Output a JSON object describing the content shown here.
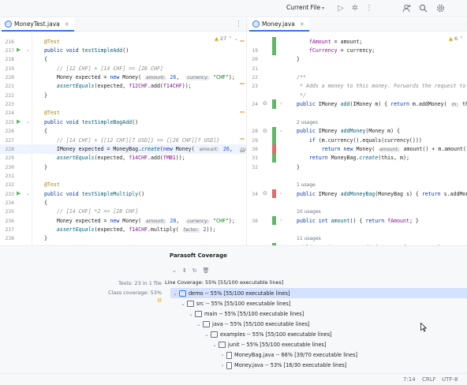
{
  "toolbar": {
    "run_config": "Current File",
    "icons": [
      "run-icon",
      "debug-icon",
      "more-icon",
      "add-user-icon",
      "search-icon",
      "settings-icon"
    ]
  },
  "left_tab": {
    "label": "MoneyTest.java"
  },
  "right_tab": {
    "label": "Money.java"
  },
  "left_editor": {
    "warning_count": "27",
    "lines": [
      {
        "n": "216",
        "parts": [
          [
            "ann",
            "@Test"
          ]
        ]
      },
      {
        "n": "217",
        "parts": [
          [
            "kw",
            "public void "
          ],
          [
            "fn",
            "testSimpleAdd"
          ],
          [
            "",
            "()"
          ]
        ]
      },
      {
        "n": "218",
        "parts": [
          [
            "",
            "{"
          ]
        ]
      },
      {
        "n": "219",
        "parts": [
          [
            "cm",
            "    // [12 CHF] + [14 CHF] == [26 CHF]"
          ]
        ]
      },
      {
        "n": "220",
        "parts": [
          [
            "",
            "    Money expected = "
          ],
          [
            "kw",
            "new "
          ],
          [
            "",
            "Money( "
          ],
          [
            "hint",
            "amount:"
          ],
          [
            "",
            " "
          ],
          [
            "num",
            "26"
          ],
          [
            "",
            ",  "
          ],
          [
            "hint",
            "currency:"
          ],
          [
            "",
            " "
          ],
          [
            "str",
            "\"CHF\""
          ],
          [
            "",
            ");"
          ]
        ]
      },
      {
        "n": "221",
        "parts": [
          [
            "st",
            "    assertEquals"
          ],
          [
            "",
            "(expected, "
          ],
          [
            "fld",
            "f12CHF"
          ],
          [
            "",
            ".add("
          ],
          [
            "fld",
            "f14CHF"
          ],
          [
            "",
            "));"
          ]
        ]
      },
      {
        "n": "222",
        "parts": [
          [
            "",
            "}"
          ]
        ]
      },
      {
        "n": "223",
        "parts": [
          [
            "",
            ""
          ]
        ]
      },
      {
        "n": "224",
        "parts": [
          [
            "ann",
            "@Test"
          ]
        ]
      },
      {
        "n": "225",
        "parts": [
          [
            "kw",
            "public void "
          ],
          [
            "fn",
            "testSimpleBagAdd"
          ],
          [
            "",
            "()"
          ]
        ]
      },
      {
        "n": "226",
        "parts": [
          [
            "",
            "{"
          ]
        ]
      },
      {
        "n": "227",
        "parts": [
          [
            "cm",
            "    // [14 CHF] + {[12 CHF][7 USD]} == {[26 CHF][7 USD]}"
          ]
        ]
      },
      {
        "n": "228",
        "parts": [
          [
            "",
            "    IMoney expected = MoneyBag."
          ],
          [
            "st",
            "create"
          ],
          [
            "",
            "("
          ],
          [
            "kw",
            "new "
          ],
          [
            "",
            "Money( "
          ],
          [
            "hint",
            "amount:"
          ],
          [
            "",
            " "
          ],
          [
            "num",
            "26"
          ],
          [
            "",
            ",  "
          ],
          [
            "hint",
            "curren"
          ]
        ]
      },
      {
        "n": "229",
        "parts": [
          [
            "st",
            "    assertEquals"
          ],
          [
            "",
            "(expected, "
          ],
          [
            "fld",
            "f14CHF"
          ],
          [
            "",
            ".add("
          ],
          [
            "fld",
            "fMB1"
          ],
          [
            "",
            "));"
          ]
        ]
      },
      {
        "n": "230",
        "parts": [
          [
            "",
            "}"
          ]
        ]
      },
      {
        "n": "231",
        "parts": [
          [
            "",
            ""
          ]
        ]
      },
      {
        "n": "232",
        "parts": [
          [
            "ann",
            "@Test"
          ]
        ]
      },
      {
        "n": "233",
        "parts": [
          [
            "kw",
            "public void "
          ],
          [
            "fn",
            "testSimpleMultiply"
          ],
          [
            "",
            "()"
          ]
        ]
      },
      {
        "n": "234",
        "parts": [
          [
            "",
            "{"
          ]
        ]
      },
      {
        "n": "235",
        "parts": [
          [
            "cm",
            "    // [14 CHF] *2 == [28 CHF]"
          ]
        ]
      },
      {
        "n": "236",
        "parts": [
          [
            "",
            "    Money expected = "
          ],
          [
            "kw",
            "new "
          ],
          [
            "",
            "Money( "
          ],
          [
            "hint",
            "amount:"
          ],
          [
            "",
            " "
          ],
          [
            "num",
            "28"
          ],
          [
            "",
            ",  "
          ],
          [
            "hint",
            "currency:"
          ],
          [
            "",
            " "
          ],
          [
            "str",
            "\"CHF\""
          ],
          [
            "",
            ");"
          ]
        ]
      },
      {
        "n": "237",
        "parts": [
          [
            "st",
            "    assertEquals"
          ],
          [
            "",
            "(expected, "
          ],
          [
            "fld",
            "f14CHF"
          ],
          [
            "",
            ".multiply( "
          ],
          [
            "hint",
            "factor:"
          ],
          [
            "",
            " "
          ],
          [
            "num",
            "2"
          ],
          [
            "",
            "));"
          ]
        ]
      },
      {
        "n": "238",
        "parts": [
          [
            "",
            "}"
          ]
        ]
      }
    ]
  },
  "right_editor": {
    "warning_count": "6",
    "lines": [
      {
        "n": "",
        "parts": [
          [
            "",
            "    "
          ],
          [
            "fld",
            "fAmount"
          ],
          [
            "",
            " = amount;"
          ]
        ]
      },
      {
        "n": "19",
        "parts": [
          [
            "",
            "    "
          ],
          [
            "fld",
            "fCurrency"
          ],
          [
            "",
            " = currency;"
          ]
        ]
      },
      {
        "n": "20",
        "parts": [
          [
            "",
            "}"
          ]
        ]
      },
      {
        "n": "21",
        "parts": [
          [
            "",
            ""
          ]
        ]
      },
      {
        "n": "22",
        "parts": [
          [
            "doc",
            "/**"
          ]
        ]
      },
      {
        "n": "23",
        "parts": [
          [
            "doc",
            " * Adds a money to this money. Forwards the request to th"
          ]
        ]
      },
      {
        "n": "",
        "parts": [
          [
            "doc",
            " */"
          ]
        ]
      },
      {
        "n": "24",
        "parts": [
          [
            "kw",
            "public "
          ],
          [
            "",
            "IMoney "
          ],
          [
            "fn",
            "add"
          ],
          [
            "",
            "(IMoney m) { "
          ],
          [
            "kw",
            "return "
          ],
          [
            "",
            "m.addMoney( "
          ],
          [
            "hint",
            "m:"
          ],
          [
            "",
            " this)"
          ]
        ]
      },
      {
        "n": "",
        "parts": [
          [
            "",
            ""
          ]
        ]
      },
      {
        "n": "",
        "parts": [
          [
            "usages",
            "2 usages"
          ]
        ]
      },
      {
        "n": "28",
        "parts": [
          [
            "kw",
            "public "
          ],
          [
            "",
            "IMoney "
          ],
          [
            "fn",
            "addMoney"
          ],
          [
            "",
            "(Money m) {"
          ]
        ]
      },
      {
        "n": "29",
        "parts": [
          [
            "kw",
            "    if "
          ],
          [
            "",
            "(m.currency().equals(currency()))"
          ]
        ]
      },
      {
        "n": "30",
        "parts": [
          [
            "kw",
            "        return new "
          ],
          [
            "",
            "Money( "
          ],
          [
            "hint",
            "amount:"
          ],
          [
            "",
            " amount() + m.amount(), c"
          ]
        ]
      },
      {
        "n": "31",
        "parts": [
          [
            "kw",
            "    return "
          ],
          [
            "",
            "MoneyBag."
          ],
          [
            "st",
            "create"
          ],
          [
            "",
            "(this, m);"
          ]
        ]
      },
      {
        "n": "32",
        "parts": [
          [
            "",
            "}"
          ]
        ]
      },
      {
        "n": "",
        "parts": [
          [
            "",
            ""
          ]
        ]
      },
      {
        "n": "",
        "parts": [
          [
            "usages",
            "1 usage"
          ]
        ]
      },
      {
        "n": "34",
        "parts": [
          [
            "kw",
            "public "
          ],
          [
            "",
            "IMoney "
          ],
          [
            "fn",
            "addMoneyBag"
          ],
          [
            "",
            "(MoneyBag s) { "
          ],
          [
            "kw",
            "return "
          ],
          [
            "",
            "s.addMoney"
          ]
        ]
      },
      {
        "n": "",
        "parts": [
          [
            "",
            ""
          ]
        ]
      },
      {
        "n": "",
        "parts": [
          [
            "usages",
            "10 usages"
          ]
        ]
      },
      {
        "n": "38",
        "parts": [
          [
            "kw",
            "public int "
          ],
          [
            "fn",
            "amount"
          ],
          [
            "",
            "() { "
          ],
          [
            "kw",
            "return "
          ],
          [
            "fld",
            "fAmount"
          ],
          [
            "",
            "; }"
          ]
        ]
      },
      {
        "n": "",
        "parts": [
          [
            "",
            ""
          ]
        ]
      },
      {
        "n": "",
        "parts": [
          [
            "usages",
            "11 usages"
          ]
        ]
      },
      {
        "n": "42",
        "parts": [
          [
            "kw",
            "public "
          ],
          [
            "",
            "String "
          ],
          [
            "fn",
            "currency"
          ],
          [
            "",
            "() { "
          ],
          [
            "kw",
            "return "
          ],
          [
            "fld",
            "fCurrency"
          ],
          [
            "",
            "; }"
          ]
        ]
      }
    ]
  },
  "coverage": {
    "title": "Parasoft Coverage",
    "tests": "Tests: 23 in 1 file",
    "class_coverage": "Class coverage: 53%",
    "line_coverage": "Line Coverage: 55% [55/100 executable lines]",
    "tree": [
      {
        "label": "demo -- 55% [55/100 executable lines]",
        "depth": 0,
        "icon": "mod",
        "open": true
      },
      {
        "label": "src -- 55% [55/100 executable lines]",
        "depth": 1,
        "icon": "dir",
        "open": true
      },
      {
        "label": "main -- 55% [55/100 executable lines]",
        "depth": 2,
        "icon": "dir",
        "open": true
      },
      {
        "label": "java -- 55% [55/100 executable lines]",
        "depth": 3,
        "icon": "dir",
        "open": true
      },
      {
        "label": "examples -- 55% [55/100 executable lines]",
        "depth": 4,
        "icon": "dir",
        "open": true
      },
      {
        "label": "junit -- 55% [55/100 executable lines]",
        "depth": 5,
        "icon": "dir",
        "open": true
      },
      {
        "label": "MoneyBag.java -- 66% [39/70 executable lines]",
        "depth": 6,
        "icon": "file",
        "open": false
      },
      {
        "label": "Money.java -- 53% [16/30 executable lines]",
        "depth": 6,
        "icon": "file",
        "open": false
      }
    ]
  },
  "status": {
    "pos": "7:14",
    "eol": "CRLF",
    "enc": "UTF-8"
  }
}
